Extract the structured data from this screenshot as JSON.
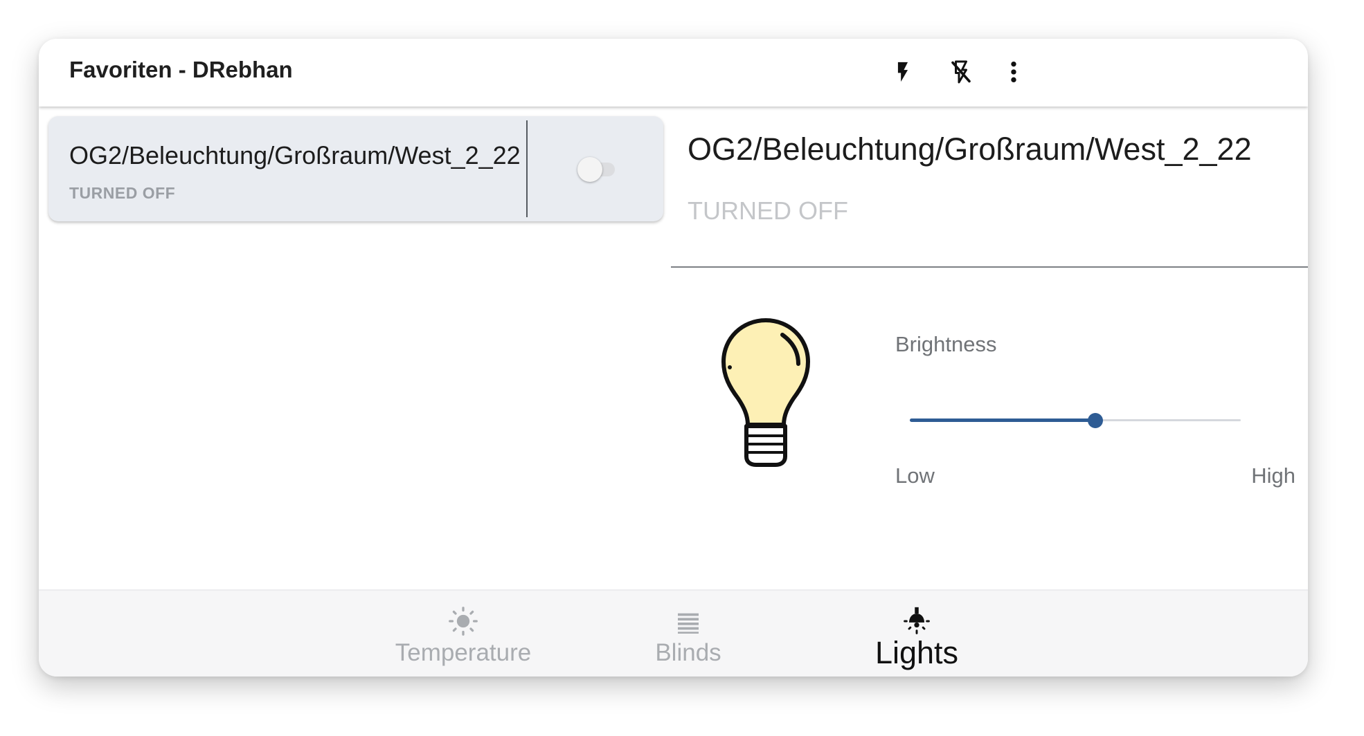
{
  "appbar": {
    "title": "Favoriten - DRebhan",
    "icons": [
      "flash-icon",
      "flash-off-icon",
      "more-vertical-icon"
    ]
  },
  "list": {
    "items": [
      {
        "title": "OG2/Beleuchtung/Großraum/West_2_22",
        "status": "TURNED OFF",
        "toggle_on": false
      }
    ]
  },
  "detail": {
    "title": "OG2/Beleuchtung/Großraum/West_2_22",
    "status": "TURNED OFF",
    "icon": "lightbulb-icon",
    "bulb_color": "#fdf0b5",
    "brightness": {
      "label": "Brightness",
      "low_label": "Low",
      "high_label": "High",
      "value": 0.56
    }
  },
  "bottom_nav": {
    "items": [
      {
        "label": "Temperature",
        "icon": "sun-icon",
        "active": false
      },
      {
        "label": "Blinds",
        "icon": "blinds-icon",
        "active": false
      },
      {
        "label": "Lights",
        "icon": "light-icon",
        "active": true
      }
    ]
  },
  "colors": {
    "accent": "#2e5c94",
    "card_background": "#e9ecf1",
    "inactive_text": "#a9acb0"
  }
}
